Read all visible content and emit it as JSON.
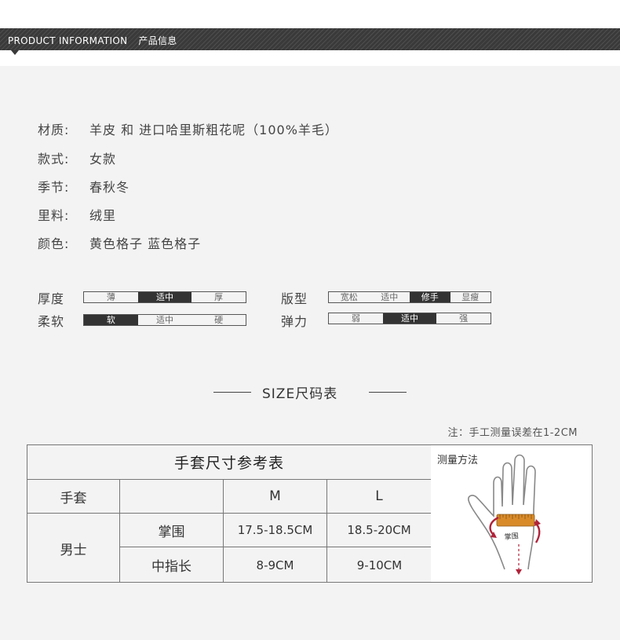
{
  "header": {
    "en": "PRODUCT INFORMATION",
    "cn": "产品信息"
  },
  "info": [
    {
      "key": "材质:",
      "value": "羊皮 和 进口哈里斯粗花呢（100%羊毛）"
    },
    {
      "key": "款式:",
      "value": "女款"
    },
    {
      "key": "季节:",
      "value": "春秋冬"
    },
    {
      "key": "里料:",
      "value": "绒里"
    },
    {
      "key": "颜色:",
      "value": "黄色格子 蓝色格子"
    }
  ],
  "scales": {
    "thickness": {
      "label": "厚度",
      "options": [
        "薄",
        "适中",
        "厚"
      ],
      "selected": "适中"
    },
    "softness": {
      "label": "柔软",
      "options": [
        "软",
        "适中",
        "硬"
      ],
      "selected": "软"
    },
    "fit": {
      "label": "版型",
      "options": [
        "宽松",
        "适中",
        "修手",
        "显瘦"
      ],
      "selected": "修手"
    },
    "elasticity": {
      "label": "弹力",
      "options": [
        "弱",
        "适中",
        "强"
      ],
      "selected": "适中"
    }
  },
  "size_section": {
    "title": "SIZE尺码表",
    "note": "注：手工测量误差在1-2CM"
  },
  "table": {
    "title": "手套尺寸参考表",
    "row_header": "手套",
    "columns": [
      "M",
      "L"
    ],
    "group": "男士",
    "rows": [
      {
        "label": "掌围",
        "values": [
          "17.5-18.5CM",
          "18.5-20CM"
        ]
      },
      {
        "label": "中指长",
        "values": [
          "8-9CM",
          "9-10CM"
        ]
      }
    ]
  },
  "method": {
    "label": "测量方法",
    "palm_label": "掌围"
  },
  "colors": {
    "header_band": "#3a3a3a",
    "ruler": "#d98b2a",
    "arrow": "#b0233a"
  }
}
